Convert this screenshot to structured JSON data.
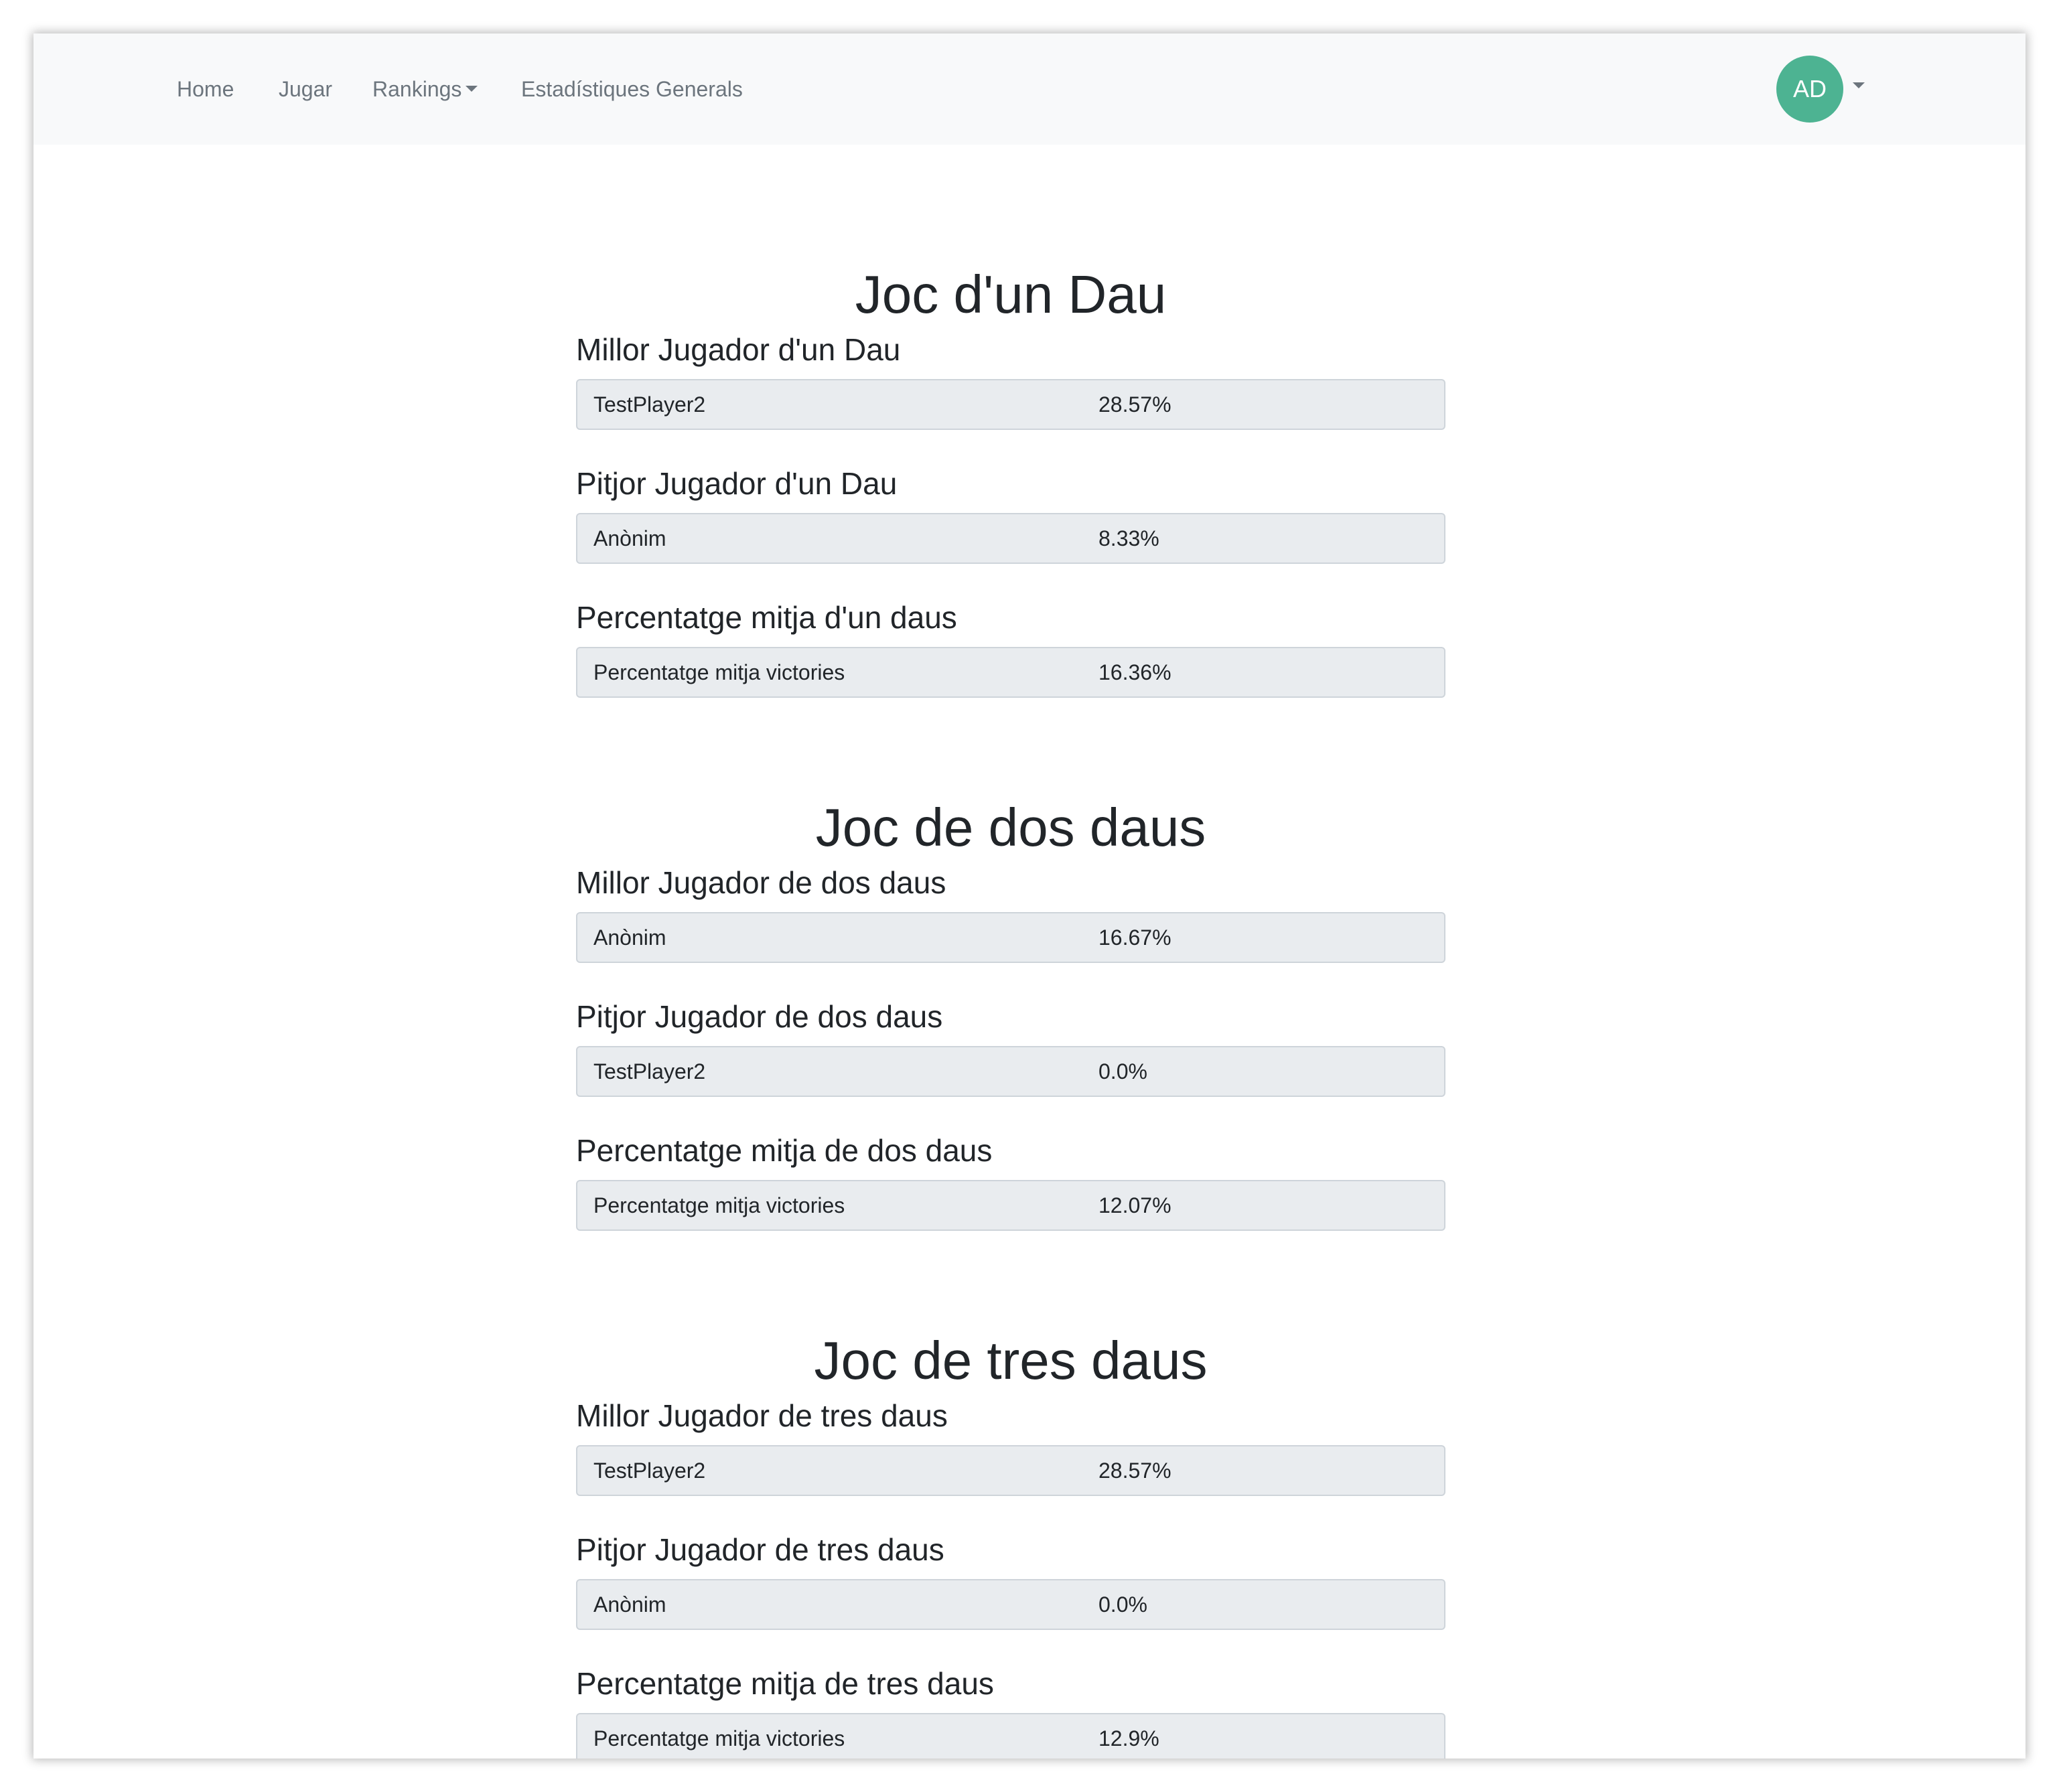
{
  "navbar": {
    "links": [
      {
        "label": "Home"
      },
      {
        "label": "Jugar"
      },
      {
        "label": "Rankings"
      },
      {
        "label": "Estadístiques Generals"
      }
    ],
    "avatar_initials": "AD",
    "avatar_color": "#4db392"
  },
  "sections": [
    {
      "title": "Joc d'un Dau",
      "blocks": [
        {
          "heading": "Millor Jugador d'un Dau",
          "label": "TestPlayer2",
          "value": "28.57%"
        },
        {
          "heading": "Pitjor Jugador d'un Dau",
          "label": "Anònim",
          "value": "8.33%"
        },
        {
          "heading": "Percentatge mitja d'un daus",
          "label": "Percentatge mitja victories",
          "value": "16.36%"
        }
      ]
    },
    {
      "title": "Joc de dos daus",
      "blocks": [
        {
          "heading": "Millor Jugador de dos daus",
          "label": "Anònim",
          "value": "16.67%"
        },
        {
          "heading": "Pitjor Jugador de dos daus",
          "label": "TestPlayer2",
          "value": "0.0%"
        },
        {
          "heading": "Percentatge mitja de dos daus",
          "label": "Percentatge mitja victories",
          "value": "12.07%"
        }
      ]
    },
    {
      "title": "Joc de tres daus",
      "blocks": [
        {
          "heading": "Millor Jugador de tres daus",
          "label": "TestPlayer2",
          "value": "28.57%"
        },
        {
          "heading": "Pitjor Jugador de tres daus",
          "label": "Anònim",
          "value": "0.0%"
        },
        {
          "heading": "Percentatge mitja de tres daus",
          "label": "Percentatge mitja victories",
          "value": "12.9%"
        }
      ]
    }
  ]
}
